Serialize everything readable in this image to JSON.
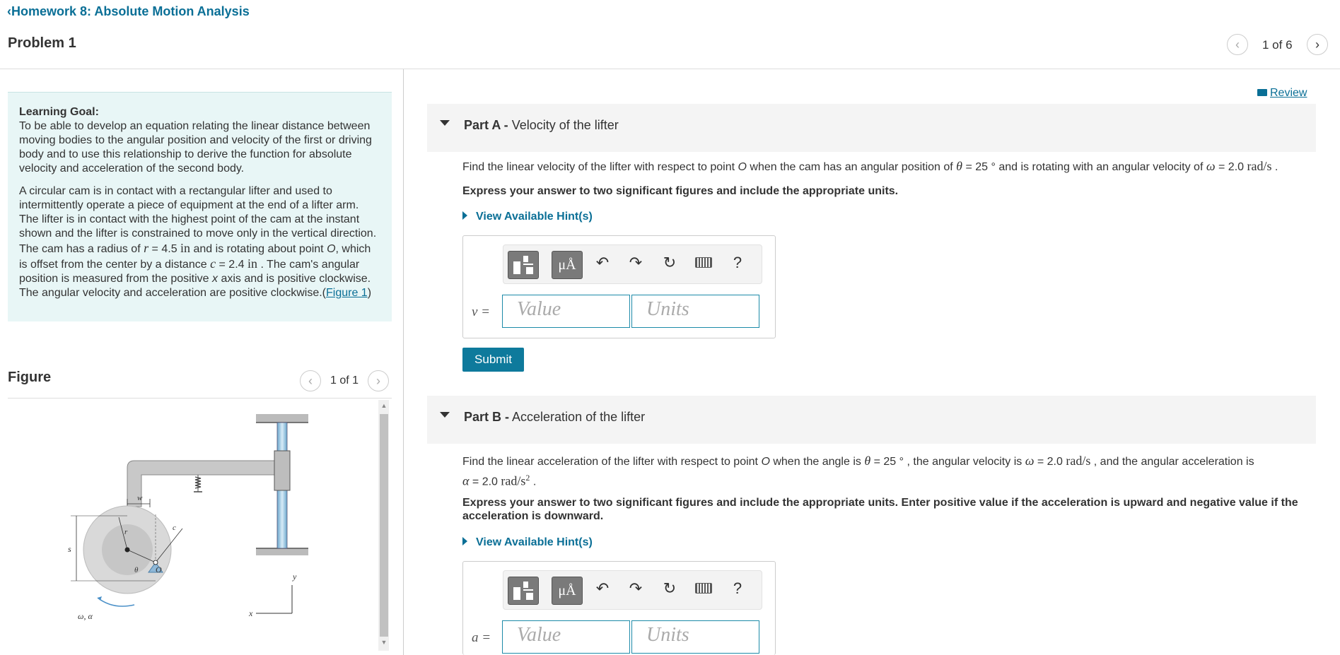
{
  "header": {
    "back_label": "Homework 8: Absolute Motion Analysis",
    "problem_title": "Problem 1",
    "page_counter": "1 of 6"
  },
  "learning_goal": {
    "title": "Learning Goal:",
    "text": "To be able to develop an equation relating the linear distance between moving bodies to the angular position and velocity of the first or driving body and to use this relationship to derive the function for absolute velocity and acceleration of the second body.",
    "desc_1": "A circular cam is in contact with a rectangular lifter and used to intermittently operate a piece of equipment at the end of a lifter arm. The lifter is in contact with the highest point of the cam at the instant shown and the lifter is constrained to move only in the vertical direction. The cam has a radius of",
    "r_sym": "r",
    "r_val": " = 4.5 ",
    "r_unit": "in",
    "desc_2": " and is rotating about point ",
    "o_sym": "O",
    "desc_3": ", which is offset from the center by a distance ",
    "c_sym": "c",
    "c_val": " = 2.4 ",
    "c_unit": "in",
    "desc_4": " . The cam's angular position is measured from the positive ",
    "x_sym": "x",
    "desc_5": " axis and is positive clockwise. The angular velocity and acceleration are positive clockwise.(",
    "figure_link": "Figure 1",
    "desc_6": ")"
  },
  "figure": {
    "title": "Figure",
    "counter": "1 of 1",
    "labels": {
      "w": "w",
      "r": "r",
      "c": "c",
      "s": "s",
      "theta": "θ",
      "O": "O",
      "y": "y",
      "x": "x",
      "omega_alpha": "ω, α"
    }
  },
  "review_label": "Review",
  "part_a": {
    "label": "Part A -",
    "title": " Velocity of the lifter",
    "q1": "Find the linear velocity of the lifter with respect to point ",
    "q_O": "O",
    "q2": " when the cam has an angular position of ",
    "theta": "θ",
    "theta_val": " = 25 ° ",
    "q3": " and is rotating with an angular velocity of ",
    "omega": "ω",
    "omega_val": " = 2.0 ",
    "omega_unit": "rad/s",
    "q4": " .",
    "instruction": "Express your answer to two significant figures and include the appropriate units.",
    "hint": "View Available Hint(s)",
    "var": "v =",
    "value_placeholder": "Value",
    "units_placeholder": "Units",
    "submit": "Submit"
  },
  "part_b": {
    "label": "Part B -",
    "title": " Acceleration of the lifter",
    "q1": "Find the linear acceleration of the lifter with respect to point ",
    "q_O": "O",
    "q2": " when the angle is ",
    "theta": "θ",
    "theta_val": " = 25 ° ",
    "q3": " , the angular velocity is ",
    "omega": "ω",
    "omega_val": " = 2.0 ",
    "omega_unit": "rad/s",
    "q4": " , and the angular acceleration is",
    "alpha": "α",
    "alpha_val": " = 2.0 ",
    "alpha_unit": "rad/s",
    "alpha_exp": "2",
    "q5": " .",
    "instruction": "Express your answer to two significant figures and include the appropriate units. Enter positive value if the acceleration is upward and negative value if the acceleration is downward.",
    "hint": "View Available Hint(s)",
    "var": "a =",
    "value_placeholder": "Value",
    "units_placeholder": "Units"
  },
  "toolbar": {
    "mu_label": "μÅ",
    "help_label": "?"
  },
  "icons": [
    "chevron-left-icon",
    "chevron-right-icon",
    "book-icon",
    "undo-icon",
    "redo-icon",
    "reset-icon",
    "keyboard-icon",
    "templates-icon"
  ]
}
